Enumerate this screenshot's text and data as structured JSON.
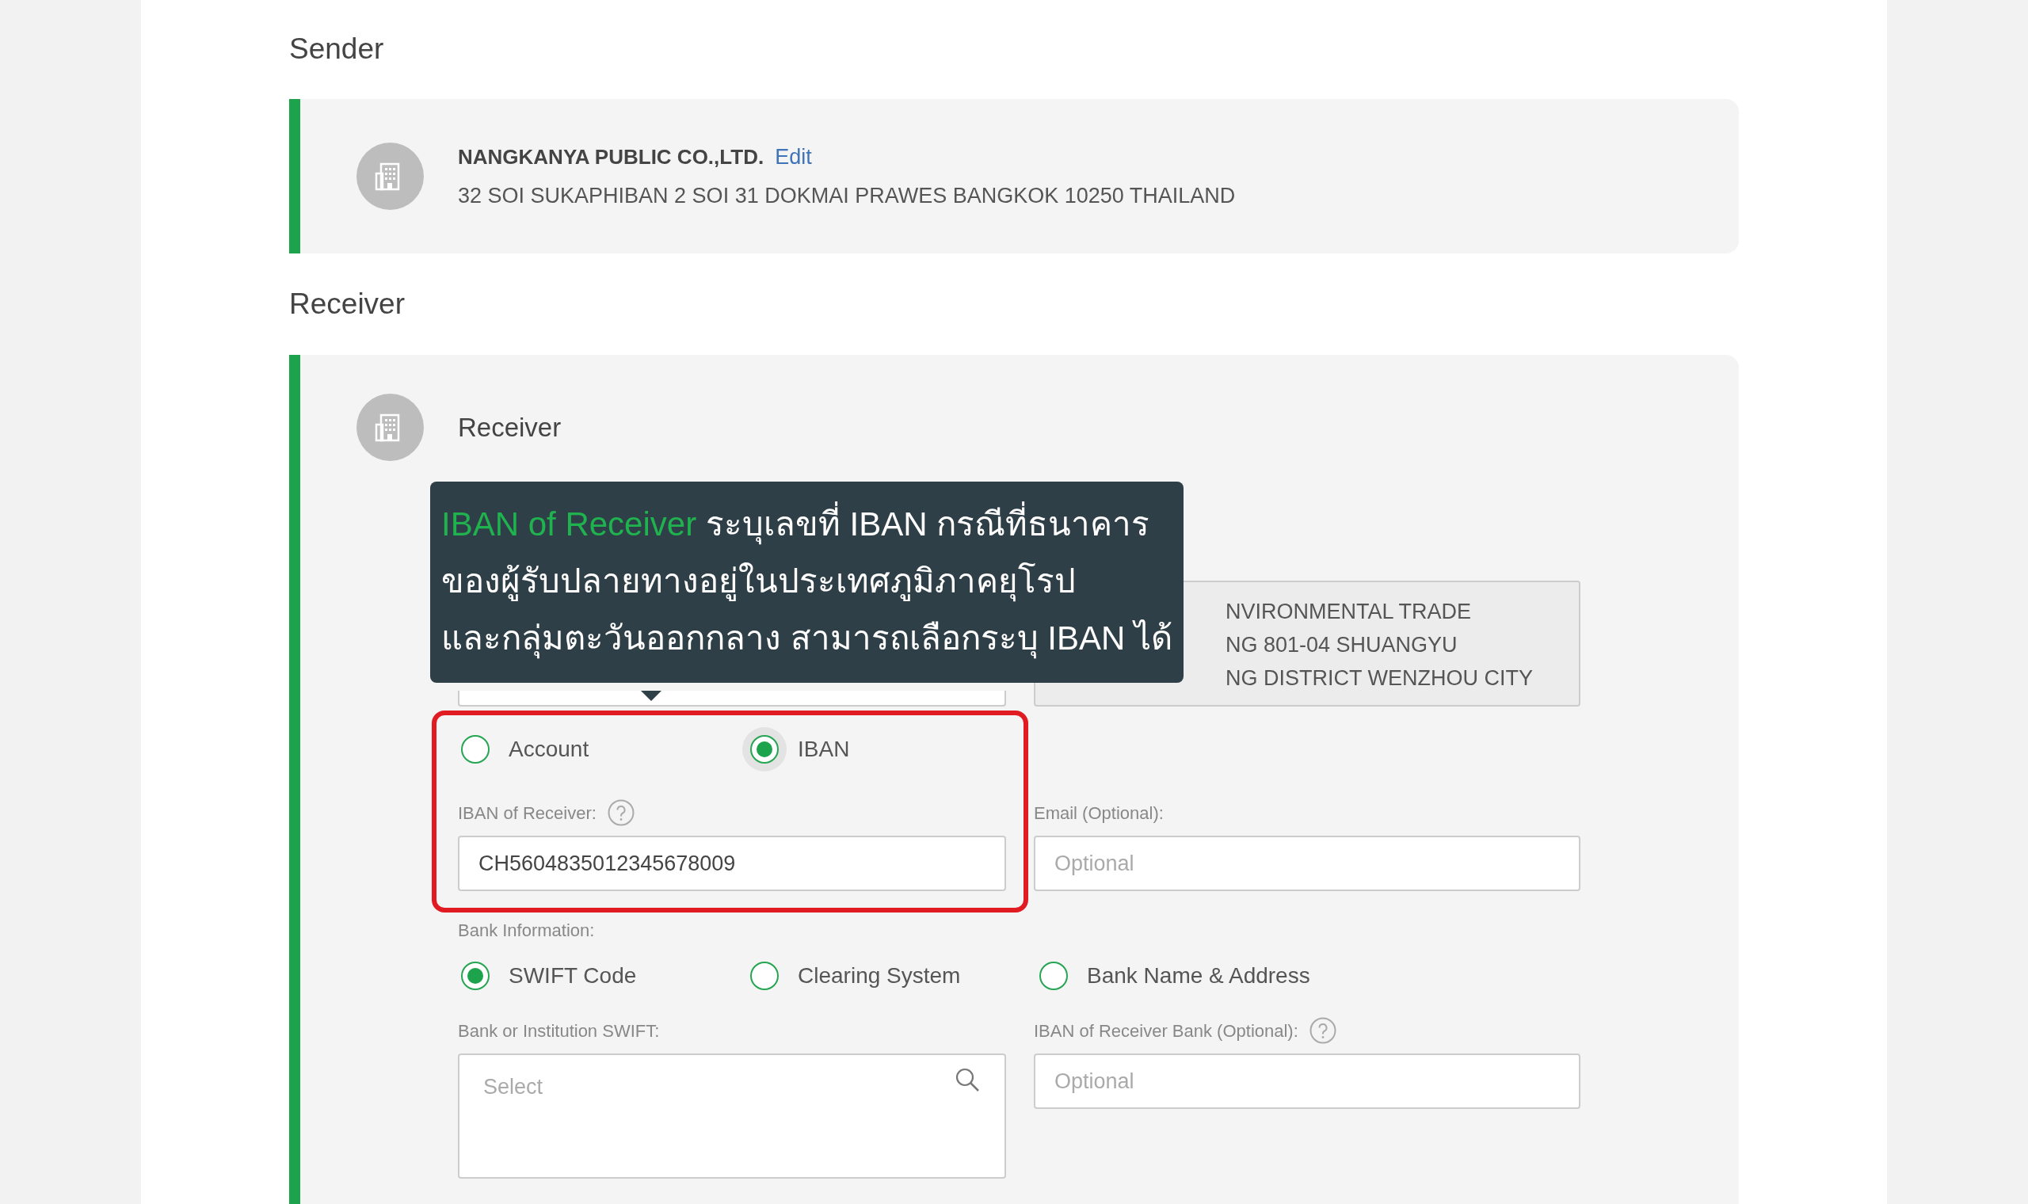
{
  "sender": {
    "heading": "Sender",
    "name": "NANGKANYA PUBLIC CO.,LTD.",
    "edit_link": "Edit",
    "address": "32 SOI SUKAPHIBAN 2 SOI 31 DOKMAI PRAWES BANGKOK 10250 THAILAND"
  },
  "receiver": {
    "heading": "Receiver",
    "card_title": "Receiver",
    "address_box_lines": [
      "NVIRONMENTAL TRADE",
      "NG 801-04 SHUANGYU",
      "NG DISTRICT WENZHOU CITY"
    ],
    "tooltip": {
      "term": "IBAN of Receiver",
      "lines": [
        "ระบุเลขที่ IBAN กรณีที่ธนาคาร",
        "ของผู้รับปลายทางอยู่ในประเทศภูมิภาคยุโรป",
        "และกลุ่มตะวันออกกลาง สามารถเลือกระบุ IBAN ได้"
      ]
    },
    "account_type": [
      {
        "label": "Account",
        "selected": false,
        "focused": false
      },
      {
        "label": "IBAN",
        "selected": true,
        "focused": true
      }
    ],
    "iban_field": {
      "label": "IBAN of Receiver:",
      "value": "CH5604835012345678009"
    },
    "email_field": {
      "label": "Email (Optional):",
      "placeholder": "Optional"
    },
    "bank_info": {
      "label": "Bank Information:",
      "options": [
        {
          "label": "SWIFT Code",
          "selected": true
        },
        {
          "label": "Clearing System",
          "selected": false
        },
        {
          "label": "Bank Name & Address",
          "selected": false
        }
      ]
    },
    "swift_field": {
      "label": "Bank or Institution SWIFT:",
      "placeholder": "Select"
    },
    "bank_iban_field": {
      "label": "IBAN of Receiver Bank (Optional):",
      "placeholder": "Optional"
    }
  }
}
